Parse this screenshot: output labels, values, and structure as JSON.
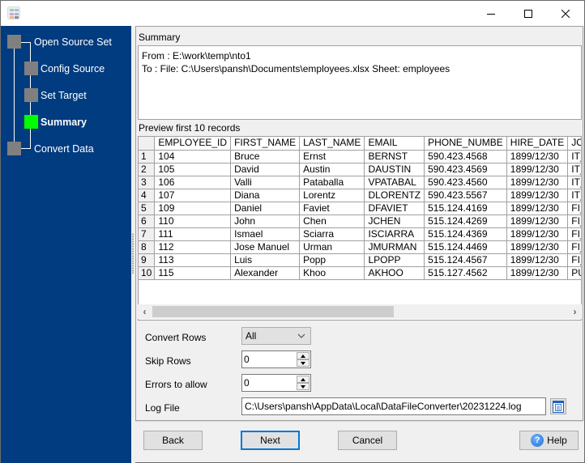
{
  "window": {
    "title": "",
    "controls": {
      "minimize": "minimize",
      "maximize": "maximize",
      "close": "close"
    }
  },
  "sidebar": {
    "steps": [
      {
        "label": "Open Source Set",
        "state": "done"
      },
      {
        "label": "Config Source",
        "state": "done"
      },
      {
        "label": "Set Target",
        "state": "done"
      },
      {
        "label": "Summary",
        "state": "active"
      },
      {
        "label": "Convert Data",
        "state": "pending"
      }
    ],
    "colors": {
      "background": "#003c7f",
      "step_inactive": "#808080",
      "step_active": "#00ff00"
    }
  },
  "summary": {
    "label": "Summary",
    "lines": [
      "From : E:\\work\\temp\\nto1",
      "To : File: C:\\Users\\pansh\\Documents\\employees.xlsx Sheet: employees"
    ]
  },
  "preview": {
    "label": "Preview first 10 records",
    "columns": [
      "EMPLOYEE_ID",
      "FIRST_NAME",
      "LAST_NAME",
      "EMAIL",
      "PHONE_NUMBE",
      "HIRE_DATE",
      "JOB_ID"
    ],
    "rows": [
      {
        "n": "1",
        "cells": [
          "104",
          "Bruce",
          "Ernst",
          "BERNST",
          "590.423.4568",
          "1899/12/30",
          "IT_PROG"
        ]
      },
      {
        "n": "2",
        "cells": [
          "105",
          "David",
          "Austin",
          "DAUSTIN",
          "590.423.4569",
          "1899/12/30",
          "IT_PROG"
        ]
      },
      {
        "n": "3",
        "cells": [
          "106",
          "Valli",
          "Pataballa",
          "VPATABAL",
          "590.423.4560",
          "1899/12/30",
          "IT_PROG"
        ]
      },
      {
        "n": "4",
        "cells": [
          "107",
          "Diana",
          "Lorentz",
          "DLORENTZ",
          "590.423.5567",
          "1899/12/30",
          "IT_PROG"
        ]
      },
      {
        "n": "5",
        "cells": [
          "109",
          "Daniel",
          "Faviet",
          "DFAVIET",
          "515.124.4169",
          "1899/12/30",
          "FI_ACCOUNT"
        ]
      },
      {
        "n": "6",
        "cells": [
          "110",
          "John",
          "Chen",
          "JCHEN",
          "515.124.4269",
          "1899/12/30",
          "FI_ACCOUNT"
        ]
      },
      {
        "n": "7",
        "cells": [
          "111",
          "Ismael",
          "Sciarra",
          "ISCIARRA",
          "515.124.4369",
          "1899/12/30",
          "FI_ACCOUNT"
        ]
      },
      {
        "n": "8",
        "cells": [
          "112",
          "Jose Manuel",
          "Urman",
          "JMURMAN",
          "515.124.4469",
          "1899/12/30",
          "FI_ACCOUNT"
        ]
      },
      {
        "n": "9",
        "cells": [
          "113",
          "Luis",
          "Popp",
          "LPOPP",
          "515.124.4567",
          "1899/12/30",
          "FI_ACCOUNT"
        ]
      },
      {
        "n": "10",
        "cells": [
          "115",
          "Alexander",
          "Khoo",
          "AKHOO",
          "515.127.4562",
          "1899/12/30",
          "PU_CLERK"
        ]
      }
    ],
    "scroll": {
      "left_arrow": "‹",
      "right_arrow": "›"
    }
  },
  "options": {
    "convert_rows": {
      "label": "Convert Rows",
      "value": "All"
    },
    "skip_rows": {
      "label": "Skip Rows",
      "value": "0"
    },
    "errors_to_allow": {
      "label": "Errors to allow",
      "value": "0"
    },
    "log_file": {
      "label": "Log File",
      "value": "C:\\Users\\pansh\\AppData\\Local\\DataFileConverter\\20231224.log"
    }
  },
  "buttons": {
    "back": "Back",
    "next": "Next",
    "cancel": "Cancel",
    "help": "Help",
    "help_glyph": "?"
  }
}
